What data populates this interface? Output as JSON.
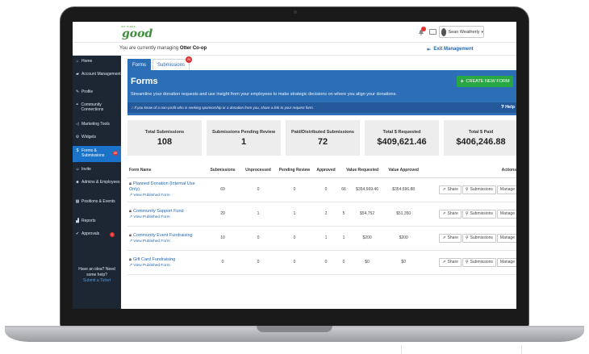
{
  "brand": {
    "logo_small": "we make",
    "logo_main": "good"
  },
  "user": {
    "name": "Sean Weatherly"
  },
  "managing": {
    "prefix": "You are currently managing",
    "org": "Otter Co-op",
    "exit_label": "Exit Management"
  },
  "sidebar": {
    "items": [
      {
        "label": "Home"
      },
      {
        "label": "Account Management"
      },
      {
        "label": "Profile"
      },
      {
        "label": "Community Connections"
      },
      {
        "label": "Marketing Tools"
      },
      {
        "label": "Widgets"
      },
      {
        "label": "Forms & Submissions",
        "badge": "20"
      },
      {
        "label": "Invite"
      },
      {
        "label": "Admins & Employees"
      },
      {
        "label": "Positions & Events"
      },
      {
        "label": "Reports"
      },
      {
        "label": "Approvals",
        "badge": "1"
      }
    ],
    "help_text": "Have an idea? Need some help?",
    "help_link": "Submit a Ticket"
  },
  "tabs": [
    {
      "label": "Forms"
    },
    {
      "label": "Submissions",
      "badge": "20"
    }
  ],
  "banner": {
    "title": "Forms",
    "subtitle": "Streamline your donation requests and use insight from your employees to make strategic decisions on where you align your donations.",
    "create_label": "CREATE NEW FORM",
    "hint": "If you know of a non-profit who is seeking sponsorship or a donation from you, share a link to your request form.",
    "help_label": "Help"
  },
  "stats": [
    {
      "label": "Total Submissions",
      "value": "108"
    },
    {
      "label": "Submissions Pending Review",
      "value": "1"
    },
    {
      "label": "Paid/Distributed Submissions",
      "value": "72"
    },
    {
      "label": "Total $ Requested",
      "value": "$409,621.46"
    },
    {
      "label": "Total $ Paid",
      "value": "$406,246.88"
    }
  ],
  "table": {
    "headers": [
      "Form Name",
      "Submissions",
      "Unprocessed",
      "Pending Review",
      "Approved",
      "Value Requested",
      "Value Approved",
      "Actions"
    ],
    "view_label": "View Published Form",
    "actions": {
      "share": "Share",
      "submissions": "Submissions",
      "manage": "Manage"
    },
    "rows": [
      {
        "name": "Planned Donation (Internal Use Only)",
        "submissions": "69",
        "unprocessed": "0",
        "pending": "0",
        "approved": "0",
        "count66": "66",
        "requested": "$354,669.46",
        "value_approved": "$354,696.88"
      },
      {
        "name": "Community Support Fund",
        "submissions": "29",
        "unprocessed": "1",
        "pending": "1",
        "approved": "2",
        "count66": "5",
        "requested": "$54,752",
        "value_approved": "$51,350"
      },
      {
        "name": "Community Event Fundraising",
        "submissions": "10",
        "unprocessed": "0",
        "pending": "0",
        "approved": "1",
        "count66": "1",
        "requested": "$200",
        "value_approved": "$200"
      },
      {
        "name": "Gift Card Fundraising",
        "submissions": "0",
        "unprocessed": "0",
        "pending": "0",
        "approved": "0",
        "count66": "0",
        "requested": "$0",
        "value_approved": "$0"
      }
    ]
  },
  "colors": {
    "primary": "#2c6fb7",
    "sidebar": "#1d2733",
    "success": "#28a745",
    "danger": "#e03131"
  }
}
